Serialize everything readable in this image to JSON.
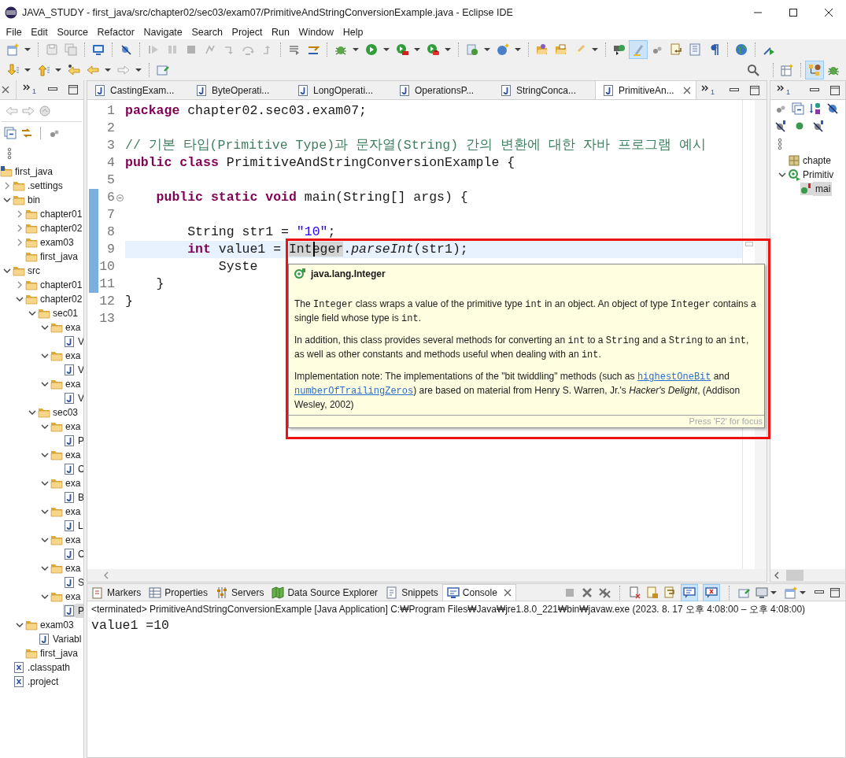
{
  "window": {
    "title": "JAVA_STUDY - first_java/src/chapter02/sec03/exam07/PrimitiveAndStringConversionExample.java - Eclipse IDE"
  },
  "menu": [
    "File",
    "Edit",
    "Source",
    "Refactor",
    "Navigate",
    "Search",
    "Project",
    "Run",
    "Window",
    "Help"
  ],
  "toolbar": {
    "mark_occurrences_on": true
  },
  "perspectives": [
    {
      "kind": "java",
      "selected": true
    },
    {
      "kind": "debug",
      "selected": false
    }
  ],
  "package_explorer": {
    "overflow_count": "1",
    "tree": [
      {
        "label": "first_java",
        "kind": "project",
        "selected": false,
        "children": [
          {
            "label": ".settings",
            "kind": "folder",
            "expanded": false,
            "selected": false
          },
          {
            "label": "bin",
            "kind": "folder",
            "expanded": true,
            "selected": false,
            "children": [
              {
                "label": "chapter01",
                "kind": "folder",
                "expanded": false,
                "selected": false
              },
              {
                "label": "chapter02",
                "kind": "folder",
                "expanded": false,
                "selected": false
              },
              {
                "label": "exam03",
                "kind": "folder",
                "expanded": false,
                "selected": false
              },
              {
                "label": "first_java",
                "kind": "folder",
                "selected": false
              }
            ]
          },
          {
            "label": "src",
            "kind": "folder",
            "expanded": true,
            "selected": false,
            "children": [
              {
                "label": "chapter01",
                "kind": "folder",
                "expanded": false,
                "selected": false
              },
              {
                "label": "chapter02",
                "kind": "folder",
                "expanded": true,
                "selected": false,
                "children": [
                  {
                    "label": "sec01",
                    "kind": "folder",
                    "expanded": true,
                    "selected": false,
                    "children": [
                      {
                        "label": "exa",
                        "kind": "folder",
                        "expanded": true,
                        "selected": false,
                        "children": [
                          {
                            "label": "V",
                            "kind": "java",
                            "selected": false
                          }
                        ]
                      },
                      {
                        "label": "exa",
                        "kind": "folder",
                        "expanded": true,
                        "selected": false,
                        "children": [
                          {
                            "label": "V",
                            "kind": "java",
                            "selected": false
                          }
                        ]
                      },
                      {
                        "label": "exa",
                        "kind": "folder",
                        "expanded": true,
                        "selected": false,
                        "children": [
                          {
                            "label": "V",
                            "kind": "java",
                            "selected": false
                          }
                        ]
                      }
                    ]
                  },
                  {
                    "label": "sec03",
                    "kind": "folder",
                    "expanded": true,
                    "selected": false,
                    "children": [
                      {
                        "label": "exa",
                        "kind": "folder",
                        "expanded": true,
                        "selected": false,
                        "children": [
                          {
                            "label": "P",
                            "kind": "java",
                            "selected": false
                          }
                        ]
                      },
                      {
                        "label": "exa",
                        "kind": "folder",
                        "expanded": true,
                        "selected": false,
                        "children": [
                          {
                            "label": "C",
                            "kind": "java",
                            "selected": false
                          }
                        ]
                      },
                      {
                        "label": "exa",
                        "kind": "folder",
                        "expanded": true,
                        "selected": false,
                        "children": [
                          {
                            "label": "B",
                            "kind": "java",
                            "selected": false
                          }
                        ]
                      },
                      {
                        "label": "exa",
                        "kind": "folder",
                        "expanded": true,
                        "selected": false,
                        "children": [
                          {
                            "label": "L",
                            "kind": "java",
                            "selected": false
                          }
                        ]
                      },
                      {
                        "label": "exa",
                        "kind": "folder",
                        "expanded": true,
                        "selected": false,
                        "children": [
                          {
                            "label": "C",
                            "kind": "java",
                            "selected": false
                          }
                        ]
                      },
                      {
                        "label": "exa",
                        "kind": "folder",
                        "expanded": true,
                        "selected": false,
                        "children": [
                          {
                            "label": "S",
                            "kind": "java",
                            "selected": false
                          }
                        ]
                      },
                      {
                        "label": "exa",
                        "kind": "folder",
                        "expanded": true,
                        "selected": false,
                        "children": [
                          {
                            "label": "P",
                            "kind": "java",
                            "selected": true
                          }
                        ]
                      }
                    ]
                  }
                ]
              },
              {
                "label": "exam03",
                "kind": "folder",
                "expanded": true,
                "selected": false,
                "children": [
                  {
                    "label": "Variabl",
                    "kind": "java",
                    "selected": false
                  }
                ]
              },
              {
                "label": "first_java",
                "kind": "folder",
                "selected": false
              }
            ]
          },
          {
            "label": ".classpath",
            "kind": "xml",
            "selected": false
          },
          {
            "label": ".project",
            "kind": "xml",
            "selected": false
          }
        ]
      }
    ]
  },
  "editor": {
    "overflow_count": "1",
    "tabs": [
      {
        "label": "CastingExam...",
        "selected": false
      },
      {
        "label": "ByteOperati...",
        "selected": false
      },
      {
        "label": "LongOperati...",
        "selected": false
      },
      {
        "label": "OperationsP...",
        "selected": false
      },
      {
        "label": "StringConca...",
        "selected": false
      },
      {
        "label": "PrimitiveAn...",
        "selected": true
      }
    ],
    "lines": [
      {
        "number": "1",
        "in_range": false,
        "current": false,
        "foldable": false,
        "segments": [
          {
            "kind": "keyword",
            "text": "package"
          },
          {
            "kind": "plain",
            "text": " chapter02.sec03.exam07;"
          }
        ]
      },
      {
        "number": "2",
        "in_range": false,
        "current": false,
        "foldable": false
      },
      {
        "number": "3",
        "in_range": false,
        "current": false,
        "foldable": false,
        "segments": [
          {
            "kind": "comment",
            "text": "// 기본 타입(Primitive Type)과 문자열(String) 간의 변환에 대한 자바 프로그램 예시"
          }
        ]
      },
      {
        "number": "4",
        "in_range": false,
        "current": false,
        "foldable": false,
        "segments": [
          {
            "kind": "keyword",
            "text": "public class"
          },
          {
            "kind": "plain",
            "text": " PrimitiveAndStringConversionExample {"
          }
        ]
      },
      {
        "number": "5",
        "in_range": false,
        "current": false,
        "foldable": false
      },
      {
        "number": "6",
        "in_range": true,
        "current": false,
        "foldable": true,
        "segments": [
          {
            "kind": "keyword",
            "text": "    public static void"
          },
          {
            "kind": "plain",
            "text": " main(String[] args) {"
          }
        ]
      },
      {
        "number": "7",
        "in_range": true,
        "current": false,
        "foldable": false
      },
      {
        "number": "8",
        "in_range": true,
        "current": false,
        "foldable": false,
        "segments": [
          {
            "kind": "plain",
            "text": "        String str1 = "
          },
          {
            "kind": "string",
            "text": "\"10\""
          },
          {
            "kind": "plain",
            "text": ";"
          }
        ]
      },
      {
        "number": "9",
        "in_range": true,
        "current": true,
        "foldable": false,
        "segments": [
          {
            "kind": "keyword",
            "text": "        int"
          },
          {
            "kind": "plain",
            "text": " value1 = "
          },
          {
            "kind": "hovered",
            "text": "Integer"
          },
          {
            "kind": "plain",
            "text": "."
          },
          {
            "kind": "static_method",
            "text": "parseInt"
          },
          {
            "kind": "plain",
            "text": "(str1);"
          }
        ]
      },
      {
        "number": "10",
        "in_range": true,
        "current": false,
        "foldable": false,
        "segments": [
          {
            "kind": "plain",
            "text": "            Syste"
          }
        ]
      },
      {
        "number": "11",
        "in_range": true,
        "current": false,
        "foldable": false,
        "segments": [
          {
            "kind": "plain",
            "text": "    }"
          }
        ]
      },
      {
        "number": "12",
        "in_range": false,
        "current": false,
        "foldable": false,
        "segments": [
          {
            "kind": "plain",
            "text": "}"
          }
        ]
      },
      {
        "number": "13",
        "in_range": false,
        "current": false,
        "foldable": false
      }
    ]
  },
  "hover": {
    "title": "java.lang.Integer",
    "paragraphs": [
      [
        {
          "kind": "text",
          "text": "The "
        },
        {
          "kind": "code",
          "text": "Integer"
        },
        {
          "kind": "text",
          "text": " class wraps a value of the primitive type "
        },
        {
          "kind": "code",
          "text": "int"
        },
        {
          "kind": "text",
          "text": " in an object. An object of type "
        },
        {
          "kind": "code",
          "text": "Integer"
        },
        {
          "kind": "text",
          "text": " contains a single field whose type is "
        },
        {
          "kind": "code",
          "text": "int"
        },
        {
          "kind": "text",
          "text": "."
        }
      ],
      [
        {
          "kind": "text",
          "text": "In addition, this class provides several methods for converting an "
        },
        {
          "kind": "code",
          "text": "int"
        },
        {
          "kind": "text",
          "text": " to a "
        },
        {
          "kind": "code",
          "text": "String"
        },
        {
          "kind": "text",
          "text": " and a "
        },
        {
          "kind": "code",
          "text": "String"
        },
        {
          "kind": "text",
          "text": " to an "
        },
        {
          "kind": "code",
          "text": "int"
        },
        {
          "kind": "text",
          "text": ", as well as other constants and methods useful when dealing with an "
        },
        {
          "kind": "code",
          "text": "int"
        },
        {
          "kind": "text",
          "text": "."
        }
      ],
      [
        {
          "kind": "text",
          "text": "Implementation note: The implementations of the \"bit twiddling\" methods (such as "
        },
        {
          "kind": "link",
          "text": "highestOneBit"
        },
        {
          "kind": "text",
          "text": " and "
        },
        {
          "kind": "link",
          "text": "numberOfTrailingZeros"
        },
        {
          "kind": "text",
          "text": ") are based on material from Henry S. Warren, Jr.'s "
        },
        {
          "kind": "italic",
          "text": "Hacker's Delight"
        },
        {
          "kind": "text",
          "text": ", (Addison Wesley, 2002)"
        }
      ]
    ],
    "hint": "Press 'F2' for focus"
  },
  "outline": {
    "overflow_count": "1",
    "items": [
      {
        "label": "chapte",
        "kind": "package",
        "selected": false
      },
      {
        "label": "Primitiv",
        "kind": "class",
        "expanded": true,
        "selected": false,
        "children": [
          {
            "label": "mai",
            "kind": "method",
            "selected": true
          }
        ]
      }
    ]
  },
  "console": {
    "tabs": [
      {
        "label": "Markers",
        "selected": false
      },
      {
        "label": "Properties",
        "selected": false
      },
      {
        "label": "Servers",
        "selected": false
      },
      {
        "label": "Data Source Explorer",
        "selected": false
      },
      {
        "label": "Snippets",
        "selected": false
      },
      {
        "label": "Console",
        "selected": true
      }
    ],
    "show_on_output": true,
    "show_on_error": true,
    "status": "<terminated> PrimitiveAndStringConversionExample [Java Application] C:₩Program Files₩Java₩jre1.8.0_221₩bin₩javaw.exe  (2023. 8. 17 오후 4:08:00 – 오후 4:08:00)",
    "output": "value1 =10"
  }
}
